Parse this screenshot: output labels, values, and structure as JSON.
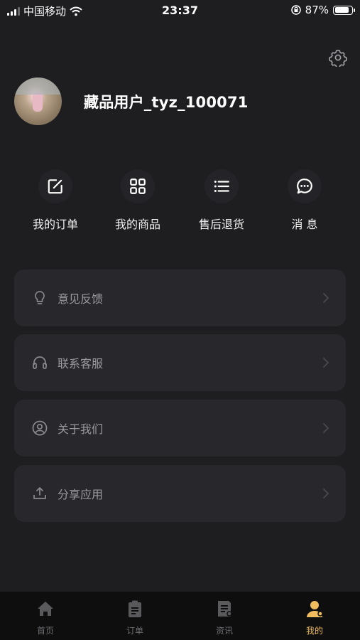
{
  "status_bar": {
    "carrier": "中国移动",
    "time": "23:37",
    "battery_percent": "87%",
    "battery_level": 0.87
  },
  "profile": {
    "username": "藏品用户_tyz_100071"
  },
  "quick_actions": [
    {
      "label": "我的订单",
      "icon": "edit-icon"
    },
    {
      "label": "我的商品",
      "icon": "grid-icon"
    },
    {
      "label": "售后退货",
      "icon": "list-icon"
    },
    {
      "label": "消 息",
      "icon": "chat-icon"
    }
  ],
  "menu": [
    {
      "label": "意见反馈",
      "icon": "lightbulb-icon"
    },
    {
      "label": "联系客服",
      "icon": "headset-icon"
    },
    {
      "label": "关于我们",
      "icon": "user-circle-icon"
    },
    {
      "label": "分享应用",
      "icon": "share-upload-icon"
    }
  ],
  "tabs": [
    {
      "label": "首页",
      "icon": "home-icon"
    },
    {
      "label": "订单",
      "icon": "clipboard-icon"
    },
    {
      "label": "资讯",
      "icon": "news-icon"
    },
    {
      "label": "我的",
      "icon": "person-icon"
    }
  ],
  "colors": {
    "background": "#1e1e21",
    "card": "#28282c",
    "active_tab": "#f0bc5e",
    "inactive_tab": "#6e6e70"
  }
}
